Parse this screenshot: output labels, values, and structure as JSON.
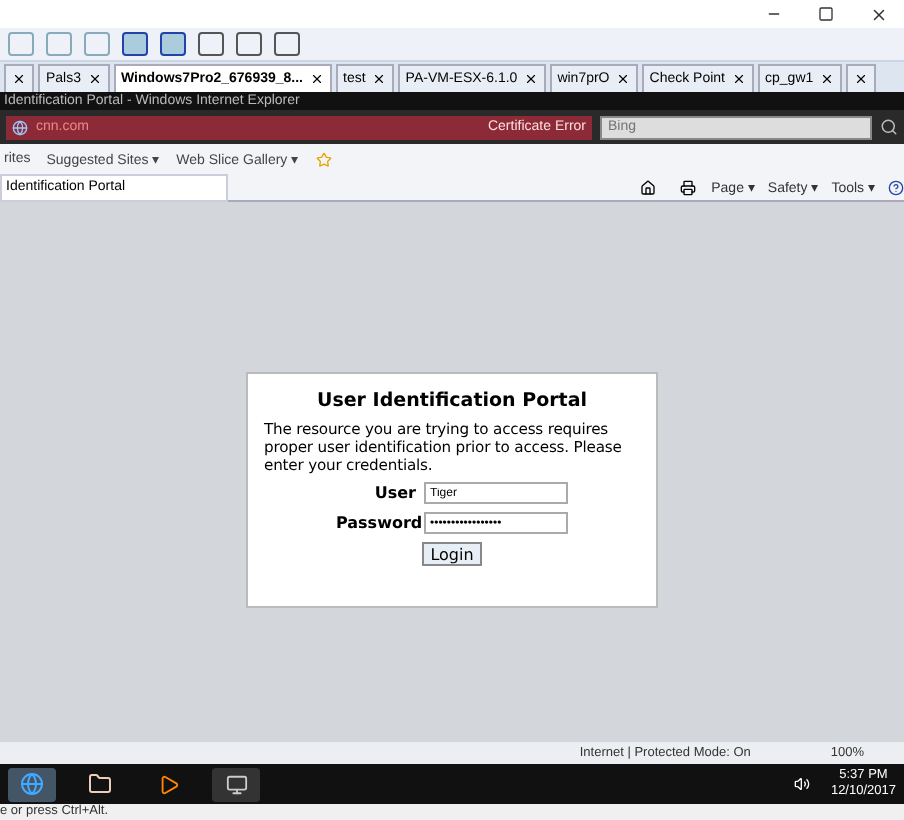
{
  "vm_tabs": [
    {
      "selected": false
    },
    {
      "label": "Pals3",
      "selected": false
    },
    {
      "label": "Windows7Pro2_676939_8...",
      "selected": true
    },
    {
      "label": "test",
      "selected": false
    },
    {
      "label": "PA-VM-ESX-6.1.0",
      "selected": false
    },
    {
      "label": "win7prO",
      "selected": false
    },
    {
      "label": "Check Point",
      "selected": false
    },
    {
      "label": "cp_gw1",
      "selected": false
    },
    {
      "selected": false
    }
  ],
  "browser": {
    "title": "Identification Portal - Windows Internet Explorer",
    "address": "cnn.com",
    "certificate_error": "Certificate Error",
    "search_placeholder": "Bing",
    "favorites": [
      {
        "label": "rites"
      },
      {
        "label": "Suggested Sites ▾"
      },
      {
        "label": "Web Slice Gallery ▾"
      }
    ],
    "tab": "Identification Portal",
    "commands": [
      "Page ▾",
      "Safety ▾",
      "Tools ▾"
    ],
    "status": "Internet | Protected Mode: On",
    "zoom": "100%"
  },
  "portal": {
    "title": "User Identification Portal",
    "message": "The resource you are trying to access requires proper user identification prior to access. Please enter your credentials.",
    "fields": [
      {
        "label": "User",
        "value": "Tiger"
      },
      {
        "label": "Password",
        "value": "•••••••••••••••••"
      }
    ],
    "button": "Login"
  },
  "taskbar": {
    "time": "5:37 PM",
    "date": "12/10/2017"
  },
  "hint": "e or press Ctrl+Alt."
}
